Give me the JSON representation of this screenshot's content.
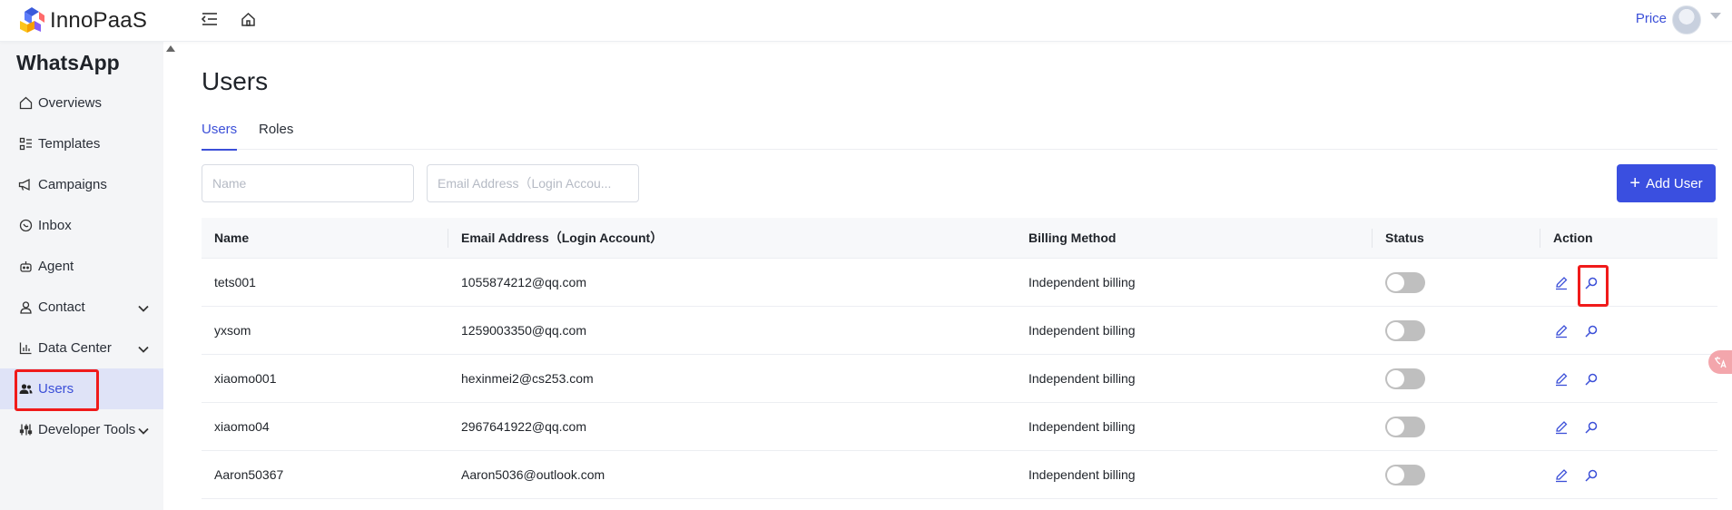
{
  "brand": {
    "name": "InnoPaaS"
  },
  "header": {
    "price_label": "Price"
  },
  "sidebar": {
    "title": "WhatsApp",
    "items": [
      {
        "label": "Overviews",
        "icon": "home-icon"
      },
      {
        "label": "Templates",
        "icon": "template-icon"
      },
      {
        "label": "Campaigns",
        "icon": "megaphone-icon"
      },
      {
        "label": "Inbox",
        "icon": "chat-icon"
      },
      {
        "label": "Agent",
        "icon": "robot-icon"
      },
      {
        "label": "Contact",
        "icon": "person-icon",
        "expandable": true
      },
      {
        "label": "Data Center",
        "icon": "bar-chart-icon",
        "expandable": true
      },
      {
        "label": "Users",
        "icon": "users-icon",
        "active": true
      },
      {
        "label": "Developer Tools",
        "icon": "tools-icon",
        "expandable": true
      }
    ]
  },
  "page": {
    "title": "Users",
    "tabs": [
      {
        "label": "Users",
        "active": true
      },
      {
        "label": "Roles"
      }
    ],
    "filters": {
      "name_placeholder": "Name",
      "email_placeholder": "Email Address（Login Accou..."
    },
    "add_button_label": "Add User"
  },
  "table": {
    "columns": [
      "Name",
      "Email Address（Login Account）",
      "Billing Method",
      "Status",
      "Action"
    ],
    "rows": [
      {
        "name": "tets001",
        "email": "1055874212@qq.com",
        "billing": "Independent billing",
        "status": "off"
      },
      {
        "name": "yxsom",
        "email": "1259003350@qq.com",
        "billing": "Independent billing",
        "status": "off"
      },
      {
        "name": "xiaomo001",
        "email": "hexinmei2@cs253.com",
        "billing": "Independent billing",
        "status": "off"
      },
      {
        "name": "xiaomo04",
        "email": "2967641922@qq.com",
        "billing": "Independent billing",
        "status": "off"
      },
      {
        "name": "Aaron50367",
        "email": "Aaron5036@outlook.com",
        "billing": "Independent billing",
        "status": "off"
      }
    ]
  },
  "colors": {
    "accent": "#3a4fe0",
    "highlight": "#f01a1a",
    "sidebar_bg": "#f4f5f7",
    "active_item_bg": "#dfe3f7"
  }
}
